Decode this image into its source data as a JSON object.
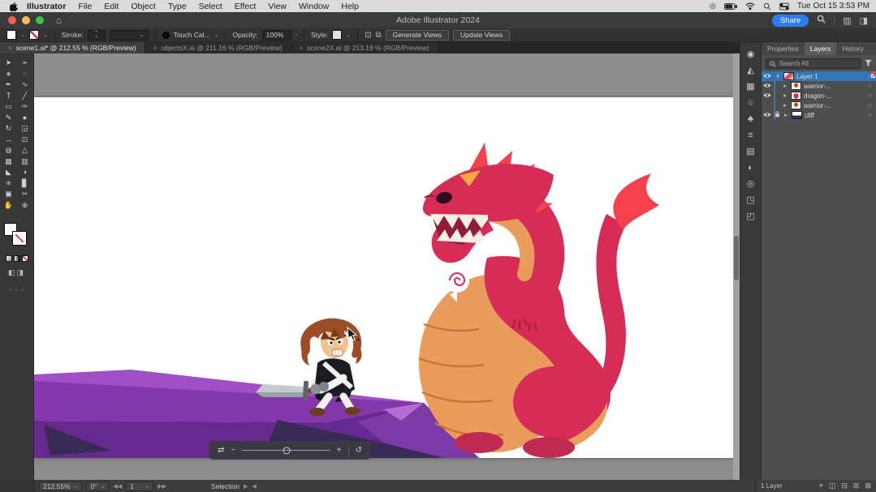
{
  "menubar": {
    "items": [
      "Illustrator",
      "File",
      "Edit",
      "Object",
      "Type",
      "Select",
      "Effect",
      "View",
      "Window",
      "Help"
    ],
    "clock": "Tue Oct 15  3:53 PM"
  },
  "titlebar": {
    "title": "Adobe Illustrator 2024",
    "share_label": "Share"
  },
  "optionsbar": {
    "stroke_label": "Stroke:",
    "brush_name": "Touch Cal...",
    "opacity_label": "Opacity:",
    "opacity_value": "100%",
    "style_label": "Style:",
    "generate_views_label": "Generate Views",
    "update_views_label": "Update Views"
  },
  "doc_tabs": [
    {
      "label": "scene1.ai* @ 212.55 % (RGB/Preview)"
    },
    {
      "label": "objectsX.ai @ 211.16 % (RGB/Preview)"
    },
    {
      "label": "scene2X.ai @ 213.19 % (RGB/Preview)"
    }
  ],
  "toolbar": {
    "tools": [
      {
        "name": "selection-tool-icon",
        "glyph": "➤"
      },
      {
        "name": "direct-selection-tool-icon",
        "glyph": "➢"
      },
      {
        "name": "magic-wand-tool-icon",
        "glyph": "∗"
      },
      {
        "name": "lasso-tool-icon",
        "glyph": "◌"
      },
      {
        "name": "pen-tool-icon",
        "glyph": "✒"
      },
      {
        "name": "curvature-tool-icon",
        "glyph": "∿"
      },
      {
        "name": "type-tool-icon",
        "glyph": "T"
      },
      {
        "name": "line-segment-tool-icon",
        "glyph": "╱"
      },
      {
        "name": "rectangle-tool-icon",
        "glyph": "▭"
      },
      {
        "name": "paintbrush-tool-icon",
        "glyph": "✑"
      },
      {
        "name": "pencil-tool-icon",
        "glyph": "✎"
      },
      {
        "name": "blob-brush-tool-icon",
        "glyph": "●"
      },
      {
        "name": "rotate-tool-icon",
        "glyph": "↻"
      },
      {
        "name": "scale-tool-icon",
        "glyph": "◲"
      },
      {
        "name": "width-tool-icon",
        "glyph": "↔"
      },
      {
        "name": "free-transform-tool-icon",
        "glyph": "⊡"
      },
      {
        "name": "shape-builder-tool-icon",
        "glyph": "◍"
      },
      {
        "name": "perspective-grid-tool-icon",
        "glyph": "△"
      },
      {
        "name": "mesh-tool-icon",
        "glyph": "▦"
      },
      {
        "name": "gradient-tool-icon",
        "glyph": "▥"
      },
      {
        "name": "eyedropper-tool-icon",
        "glyph": "◣"
      },
      {
        "name": "blend-tool-icon",
        "glyph": "◑"
      },
      {
        "name": "symbol-sprayer-tool-icon",
        "glyph": "✳"
      },
      {
        "name": "column-graph-tool-icon",
        "glyph": "▊"
      },
      {
        "name": "artboard-tool-icon",
        "glyph": "▣"
      },
      {
        "name": "slice-tool-icon",
        "glyph": "✂"
      },
      {
        "name": "hand-tool-icon",
        "glyph": "✋"
      },
      {
        "name": "zoom-tool-icon",
        "glyph": "⊕"
      }
    ]
  },
  "dock": {
    "icons": [
      {
        "name": "color-panel-icon",
        "glyph": "◉"
      },
      {
        "name": "pathfinder-panel-icon",
        "glyph": "◭"
      },
      {
        "name": "artboards-panel-icon",
        "glyph": "▦"
      },
      {
        "name": "libraries-panel-icon",
        "glyph": "♧"
      },
      {
        "name": "symbols-panel-icon",
        "glyph": "♣"
      },
      {
        "name": "stroke-panel-icon",
        "glyph": "≡"
      },
      {
        "name": "gradient-panel-icon",
        "glyph": "▤"
      },
      {
        "name": "transparency-panel-icon",
        "glyph": "◐"
      },
      {
        "name": "appearance-panel-icon",
        "glyph": "◎"
      },
      {
        "name": "export-panel-icon",
        "glyph": "◳"
      },
      {
        "name": "asset-export-panel-icon",
        "glyph": "◰"
      }
    ]
  },
  "layers_panel": {
    "tabs": [
      "Properties",
      "Layers",
      "History"
    ],
    "search_placeholder": "Search All",
    "rows": [
      {
        "name": "Layer 1"
      },
      {
        "name": "warrior-..."
      },
      {
        "name": "dragon-..."
      },
      {
        "name": "warrior-..."
      },
      {
        "name": "cliff"
      }
    ],
    "footer_count": "1 Layer",
    "footer_icons": [
      {
        "name": "locate-object-icon",
        "glyph": "⌖"
      },
      {
        "name": "clipping-mask-icon",
        "glyph": "◫"
      },
      {
        "name": "new-sublayer-icon",
        "glyph": "⊟"
      },
      {
        "name": "new-layer-icon",
        "glyph": "⊞"
      },
      {
        "name": "delete-layer-icon",
        "glyph": "⊠"
      }
    ]
  },
  "statusbar": {
    "zoom": "212.55%",
    "rotation": "0°",
    "artboard_number": "1",
    "tool_name": "Selection"
  },
  "ui_glyphs": {
    "home": "⌂",
    "close": "×",
    "caret": "⌄",
    "caret_up": "⌃",
    "submenu": "›",
    "chevron_right": "▸",
    "chevron_down": "▾",
    "target": "○",
    "minus": "−",
    "plus": "+",
    "swap": "⇄",
    "rotate_view": "↺",
    "nav_first": "◀◀",
    "nav_prev": "◀",
    "nav_next": "▶",
    "nav_last": "▶▶",
    "pane_left": "▶",
    "pane_right": "◀",
    "arrange_docs": "▥",
    "workspace": "◨",
    "menu_extra": "◎",
    "draw_modes": "◧◨",
    "more_dots": "· · ·"
  },
  "colors": {
    "accent_blue": "#2e7bf6",
    "selection_blue": "#3276b5",
    "dragon_body": "#d62c56",
    "dragon_belly": "#ea9c5d",
    "dragon_accent": "#f4414b",
    "cliff_top": "#8238ab",
    "cliff_front": "#66298f",
    "cliff_dark": "#3a2b56"
  }
}
